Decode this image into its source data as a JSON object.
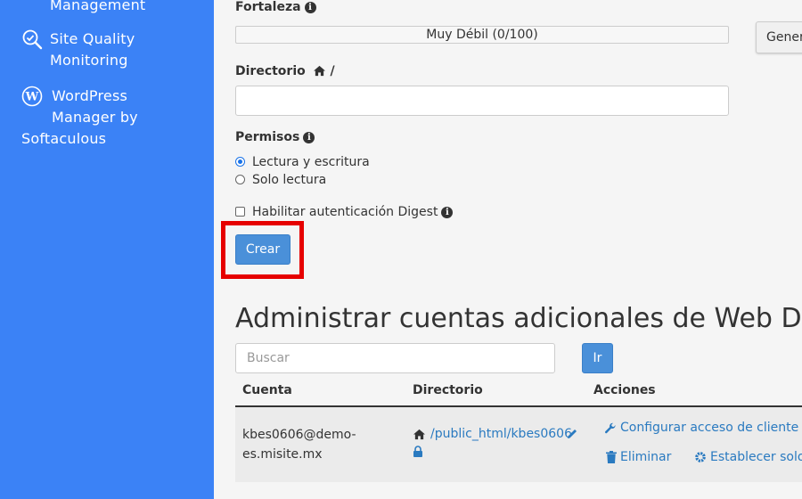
{
  "sidebar": {
    "items": [
      {
        "label_lines": [
          "Management"
        ],
        "icon": "management-icon"
      },
      {
        "label_lines": [
          "Site Quality",
          "Monitoring"
        ],
        "icon": "site-quality-icon"
      },
      {
        "label_lines": [
          "WordPress",
          "Manager by",
          "Softaculous"
        ],
        "icon": "wordpress-icon"
      }
    ]
  },
  "form": {
    "strength_label": "Fortaleza",
    "strength_value": "Muy Débil (0/100)",
    "generate_button": "Gener",
    "directory_label": "Directorio",
    "directory_suffix": "/",
    "directory_value": "",
    "permissions_label": "Permisos",
    "permission_options": [
      "Lectura y escritura",
      "Solo lectura"
    ],
    "selected_permission": "Lectura y escritura",
    "digest_label": "Habilitar autenticación Digest",
    "create_button": "Crear"
  },
  "manage": {
    "title": "Administrar cuentas adicionales de Web Disk",
    "search_placeholder": "Buscar",
    "go_button": "Ir",
    "columns": [
      "Cuenta",
      "Directorio",
      "Acciones"
    ],
    "rows": [
      {
        "account_lines": [
          "kbes0606@demo-",
          "es.misite.mx"
        ],
        "directory": "/public_html/kbes0606",
        "actions": {
          "configure": "Configurar acceso de cliente",
          "delete": "Eliminar",
          "set_readonly": "Establecer solo l"
        }
      }
    ]
  },
  "colors": {
    "sidebar_bg": "#3b82f6",
    "primary_button": "#4a90d9",
    "highlight": "#e60000",
    "link": "#2a7ac0"
  }
}
